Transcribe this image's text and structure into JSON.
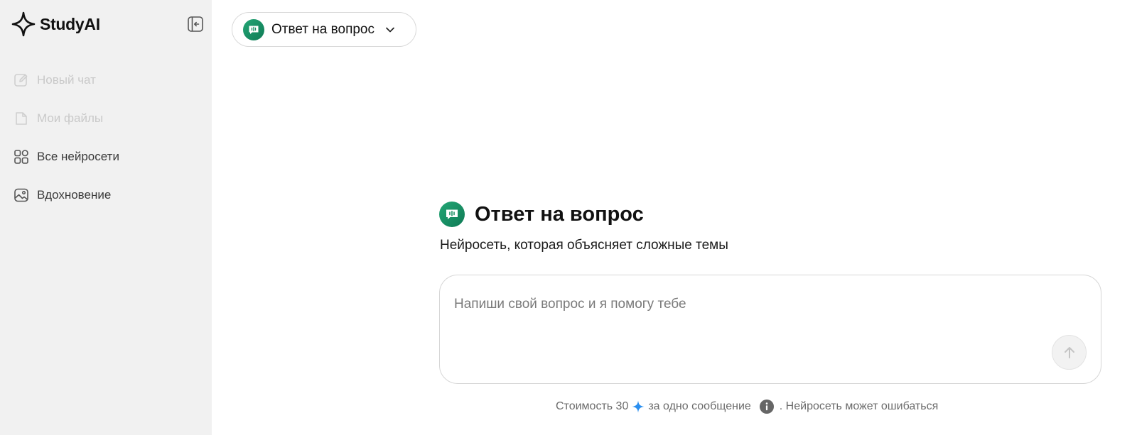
{
  "brand": {
    "name": "StudyAI"
  },
  "sidebar": {
    "items": [
      {
        "label": "Новый чат",
        "icon": "edit-icon",
        "disabled": true
      },
      {
        "label": "Мои файлы",
        "icon": "file-icon",
        "disabled": true
      },
      {
        "label": "Все нейросети",
        "icon": "grid-icon",
        "disabled": false
      },
      {
        "label": "Вдохновение",
        "icon": "image-icon",
        "disabled": false
      }
    ]
  },
  "mode_picker": {
    "label": "Ответ на вопрос",
    "icon": "chat-bubble-icon"
  },
  "hero": {
    "title": "Ответ на вопрос",
    "subtitle": "Нейросеть, которая объясняет сложные темы"
  },
  "prompt": {
    "placeholder": "Напиши свой вопрос и я помогу тебе",
    "value": ""
  },
  "footer": {
    "cost_prefix": "Стоимость 30",
    "cost_suffix": "за одно сообщение",
    "warning": ". Нейросеть может ошибаться"
  },
  "colors": {
    "sidebar_bg": "#f1f1f1",
    "accent_green_start": "#23a675",
    "accent_green_end": "#0f7a55",
    "spark_blue": "#2a8ff0"
  }
}
